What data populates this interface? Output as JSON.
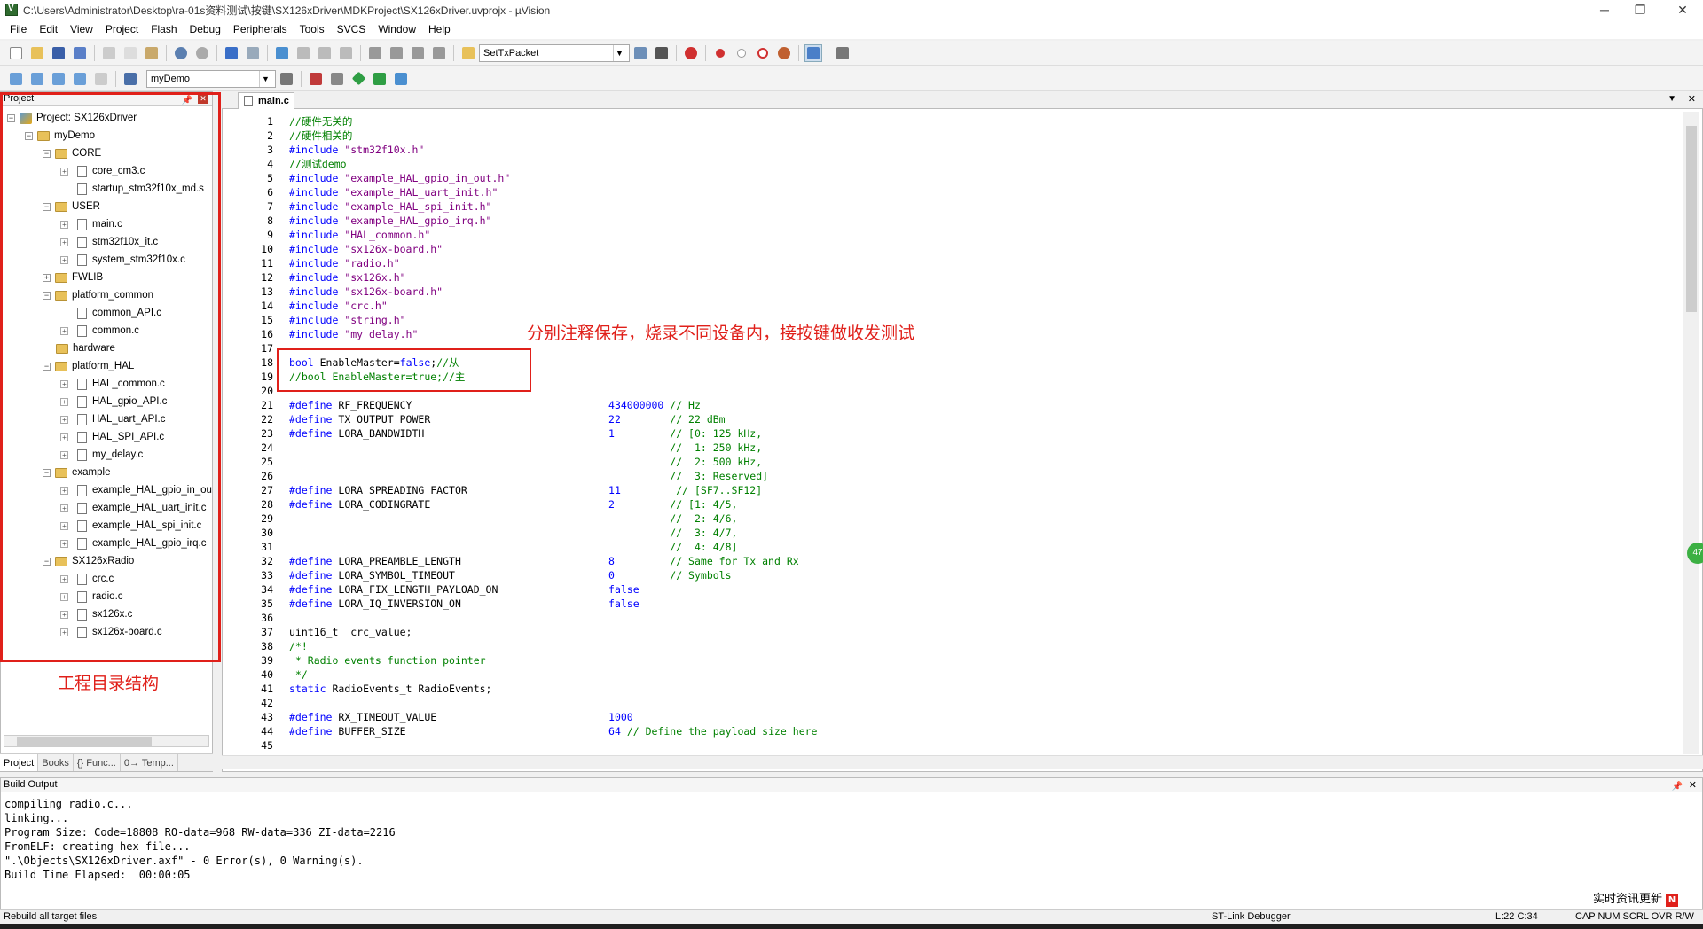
{
  "window": {
    "title": "C:\\Users\\Administrator\\Desktop\\ra-01s资料测试\\按键\\SX126xDriver\\MDKProject\\SX126xDriver.uvprojx - µVision",
    "minimize": "─",
    "maximize": "❐",
    "close": "✕"
  },
  "menu": [
    "File",
    "Edit",
    "View",
    "Project",
    "Flash",
    "Debug",
    "Peripherals",
    "Tools",
    "SVCS",
    "Window",
    "Help"
  ],
  "toolbar1": {
    "find_combo": "SetTxPacket"
  },
  "toolbar2": {
    "target_combo": "myDemo"
  },
  "project_panel": {
    "title": "Project",
    "root": "Project: SX126xDriver",
    "target": "myDemo",
    "groups": [
      {
        "name": "CORE",
        "files": [
          "core_cm3.c",
          "startup_stm32f10x_md.s"
        ]
      },
      {
        "name": "USER",
        "files": [
          "main.c",
          "stm32f10x_it.c",
          "system_stm32f10x.c"
        ]
      },
      {
        "name": "FWLIB",
        "files": []
      },
      {
        "name": "platform_common",
        "files": [
          "common_API.c",
          "common.c"
        ]
      },
      {
        "name": "hardware",
        "files": []
      },
      {
        "name": "platform_HAL",
        "files": [
          "HAL_common.c",
          "HAL_gpio_API.c",
          "HAL_uart_API.c",
          "HAL_SPI_API.c",
          "my_delay.c"
        ]
      },
      {
        "name": "example",
        "files": [
          "example_HAL_gpio_in_ou",
          "example_HAL_uart_init.c",
          "example_HAL_spi_init.c",
          "example_HAL_gpio_irq.c"
        ]
      },
      {
        "name": "SX126xRadio",
        "files": [
          "crc.c",
          "radio.c",
          "sx126x.c",
          "sx126x-board.c"
        ]
      }
    ],
    "tabs": [
      "Project",
      "Books",
      "{} Func...",
      "0→ Temp..."
    ],
    "annotation": "工程目录结构"
  },
  "editor": {
    "tab": "main.c",
    "annotation": "分别注释保存，烧录不同设备内，接按键做收发测试",
    "lines": [
      "//硬件无关的",
      "//硬件相关的",
      "#include \"stm32f10x.h\"",
      "//测试demo",
      "#include \"example_HAL_gpio_in_out.h\"",
      "#include \"example_HAL_uart_init.h\"",
      "#include \"example_HAL_spi_init.h\"",
      "#include \"example_HAL_gpio_irq.h\"",
      "#include \"HAL_common.h\"",
      "#include \"sx126x-board.h\"",
      "#include \"radio.h\"",
      "#include \"sx126x.h\"",
      "#include \"sx126x-board.h\"",
      "#include \"crc.h\"",
      "#include \"string.h\"",
      "#include \"my_delay.h\"",
      "",
      "bool EnableMaster=false;//从",
      "//bool EnableMaster=true;//主",
      "",
      "#define RF_FREQUENCY                                434000000 // Hz",
      "#define TX_OUTPUT_POWER                             22        // 22 dBm",
      "#define LORA_BANDWIDTH                              1         // [0: 125 kHz,",
      "                                                              //  1: 250 kHz,",
      "                                                              //  2: 500 kHz,",
      "                                                              //  3: Reserved]",
      "#define LORA_SPREADING_FACTOR                       11         // [SF7..SF12]",
      "#define LORA_CODINGRATE                             2         // [1: 4/5,",
      "                                                              //  2: 4/6,",
      "                                                              //  3: 4/7,",
      "                                                              //  4: 4/8]",
      "#define LORA_PREAMBLE_LENGTH                        8         // Same for Tx and Rx",
      "#define LORA_SYMBOL_TIMEOUT                         0         // Symbols",
      "#define LORA_FIX_LENGTH_PAYLOAD_ON                  false",
      "#define LORA_IQ_INVERSION_ON                        false",
      "",
      "uint16_t  crc_value;",
      "/*!",
      " * Radio events function pointer",
      " */",
      "static RadioEvents_t RadioEvents;",
      "",
      "#define RX_TIMEOUT_VALUE                            1000",
      "#define BUFFER_SIZE                                 64 // Define the payload size here",
      ""
    ]
  },
  "build_output": {
    "title": "Build Output",
    "lines": [
      "compiling radio.c...",
      "linking...",
      "Program Size: Code=18808 RO-data=968 RW-data=336 ZI-data=2216",
      "FromELF: creating hex file...",
      "\".\\Objects\\SX126xDriver.axf\" - 0 Error(s), 0 Warning(s).",
      "Build Time Elapsed:  00:00:05"
    ]
  },
  "status": {
    "left": "Rebuild all target files",
    "debugger": "ST-Link Debugger",
    "position": "L:22 C:34",
    "indicators": "CAP  NUM  SCRL  OVR  R/W"
  },
  "notification": {
    "text": "实时资讯更新",
    "badge": "N"
  },
  "side_badge": "47"
}
